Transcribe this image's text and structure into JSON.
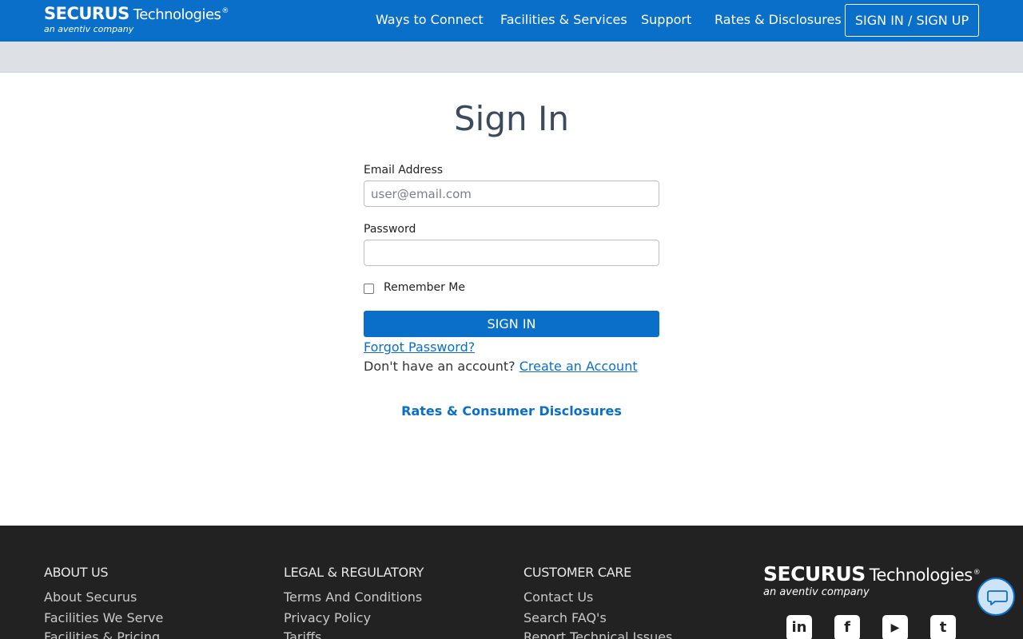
{
  "header": {
    "logo_brand": "SECURUS",
    "logo_tech": "Technologies",
    "logo_reg": "®",
    "logo_sub": "an aventiv company",
    "nav": [
      "Ways to Connect",
      "Facilities & Services",
      "Support",
      "Rates & Disclosures"
    ],
    "signin_label": "SIGN IN / SIGN UP"
  },
  "form": {
    "title": "Sign In",
    "email_label": "Email Address",
    "email_placeholder": "user@email.com",
    "email_value": "",
    "password_label": "Password",
    "password_value": "",
    "remember_label": "Remember Me",
    "remember_checked": false,
    "submit_label": "SIGN IN",
    "forgot_link": "Forgot Password?",
    "no_account_text": "Don't have an account?",
    "create_link": "Create an Account",
    "rates_link": "Rates & Consumer Disclosures"
  },
  "footer": {
    "columns": [
      {
        "title": "ABOUT US",
        "items": [
          "About Securus",
          "Facilities We Serve",
          "Facilities & Pricing"
        ]
      },
      {
        "title": "LEGAL & REGULATORY",
        "items": [
          "Terms And Conditions",
          "Privacy Policy",
          "Tariffs"
        ]
      },
      {
        "title": "CUSTOMER CARE",
        "items": [
          "Contact Us",
          "Search FAQ's",
          "Report Technical Issues"
        ]
      }
    ],
    "logo_brand": "SECURUS",
    "logo_tech": "Technologies",
    "logo_reg": "®",
    "logo_sub": "an aventiv company",
    "social": [
      {
        "icon": "linkedin-icon",
        "glyph": "in"
      },
      {
        "icon": "facebook-icon",
        "glyph": "f"
      },
      {
        "icon": "youtube-icon",
        "glyph": "▶"
      },
      {
        "icon": "twitter-icon",
        "glyph": "t"
      }
    ]
  },
  "colors": {
    "brand_blue": "#0a6fc9",
    "footer_bg": "#222222",
    "greybar": "#dde1e5"
  }
}
